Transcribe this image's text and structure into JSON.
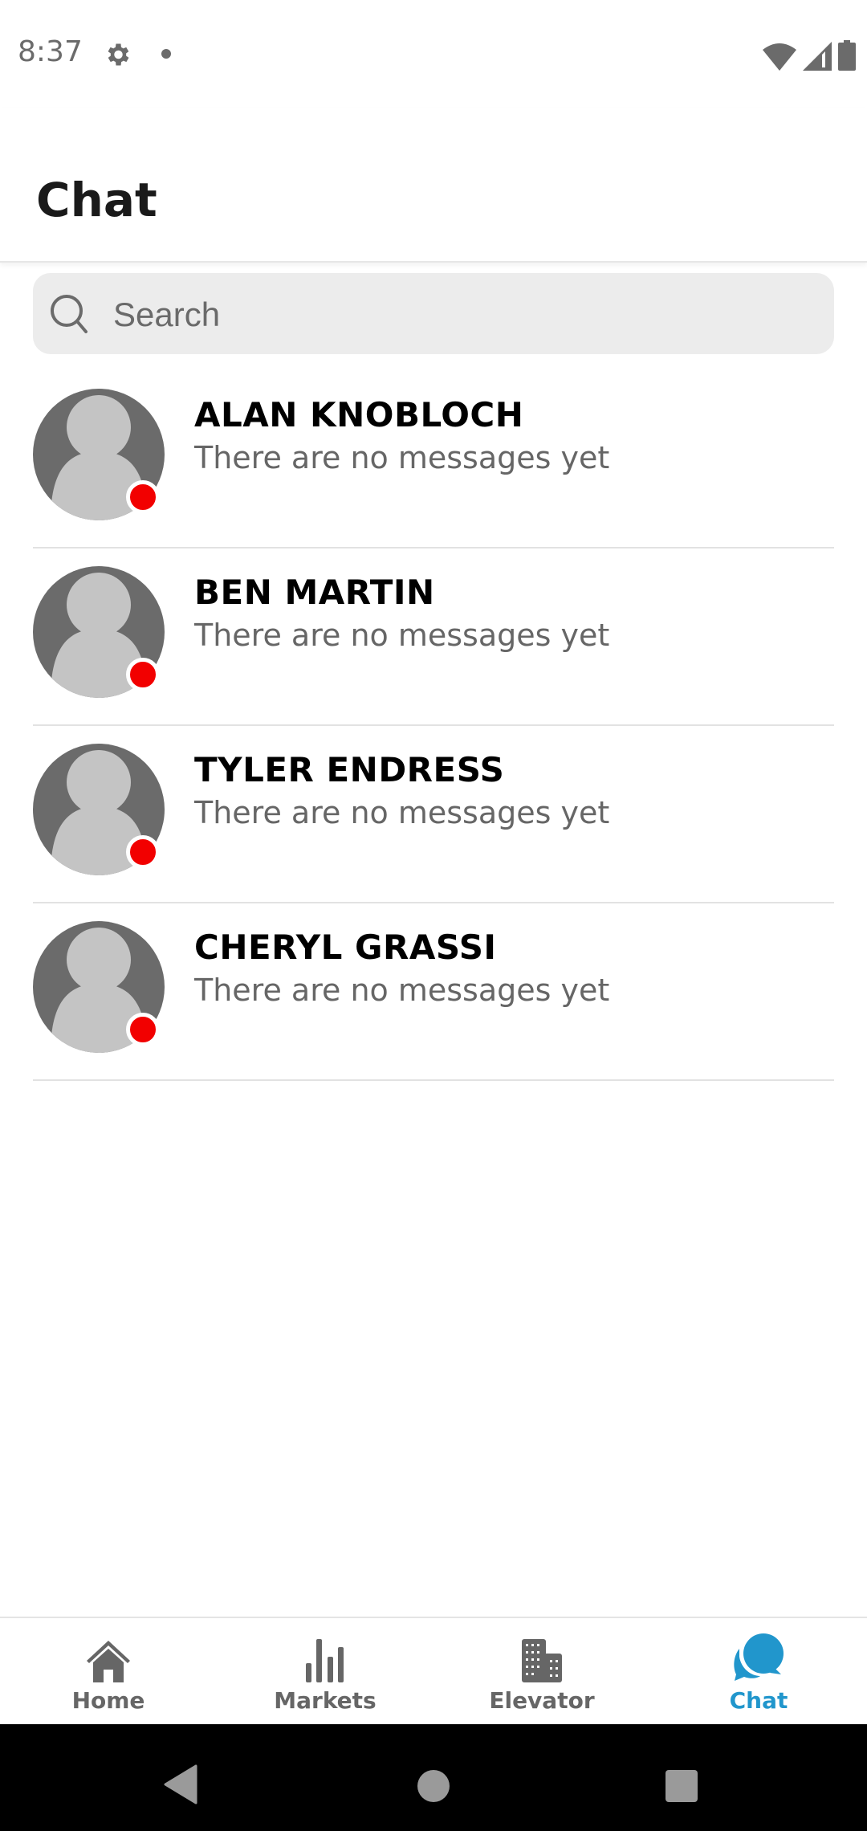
{
  "status_bar": {
    "time": "8:37",
    "icons": [
      "gear-icon",
      "notification-dot",
      "wifi-icon",
      "signal-icon",
      "battery-icon"
    ]
  },
  "header": {
    "title": "Chat"
  },
  "search": {
    "placeholder": "Search",
    "value": "",
    "icon": "search-icon"
  },
  "contacts": [
    {
      "name": "ALAN KNOBLOCH",
      "preview": "There are no messages yet",
      "status": "offline"
    },
    {
      "name": "BEN MARTIN",
      "preview": "There are no messages yet",
      "status": "offline"
    },
    {
      "name": "TYLER ENDRESS",
      "preview": "There are no messages yet",
      "status": "offline"
    },
    {
      "name": "CHERYL GRASSI",
      "preview": "There are no messages yet",
      "status": "offline"
    }
  ],
  "bottom_nav": {
    "items": [
      {
        "label": "Home",
        "icon": "home-icon",
        "active": false
      },
      {
        "label": "Markets",
        "icon": "bar-chart-icon",
        "active": false
      },
      {
        "label": "Elevator",
        "icon": "building-icon",
        "active": false
      },
      {
        "label": "Chat",
        "icon": "chat-bubbles-icon",
        "active": true
      }
    ]
  },
  "colors": {
    "accent": "#2196cc",
    "presence_offline": "#f20000",
    "avatar_bg": "#6b6b6b",
    "avatar_fg": "#c4c4c4",
    "icon_gray": "#666666"
  }
}
